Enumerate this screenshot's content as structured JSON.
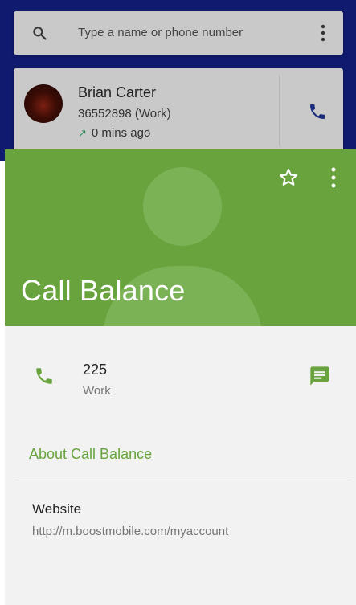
{
  "search": {
    "placeholder": "Type a name or phone number",
    "icon": "search-icon",
    "more_icon": "more-vert-icon"
  },
  "recent_call": {
    "name": "Brian Carter",
    "number": "36552898 (Work)",
    "time": "0 mins ago",
    "direction_icon": "outgoing-call-arrow-icon",
    "action_icon": "phone-icon"
  },
  "contact": {
    "name": "Call Balance",
    "header_color": "#68a33d",
    "star_icon": "star-outline-icon",
    "more_icon": "more-vert-icon",
    "phone": {
      "number": "225",
      "type": "Work",
      "icon": "phone-icon",
      "message_icon": "message-icon"
    },
    "about_heading": "About Call Balance",
    "website": {
      "label": "Website",
      "url": "http://m.boostmobile.com/myaccount"
    }
  },
  "colors": {
    "accent": "#68a33d",
    "dialer_background": "#101a6e",
    "card_background": "#c9c9c9",
    "details_background": "#f2f2f2"
  }
}
